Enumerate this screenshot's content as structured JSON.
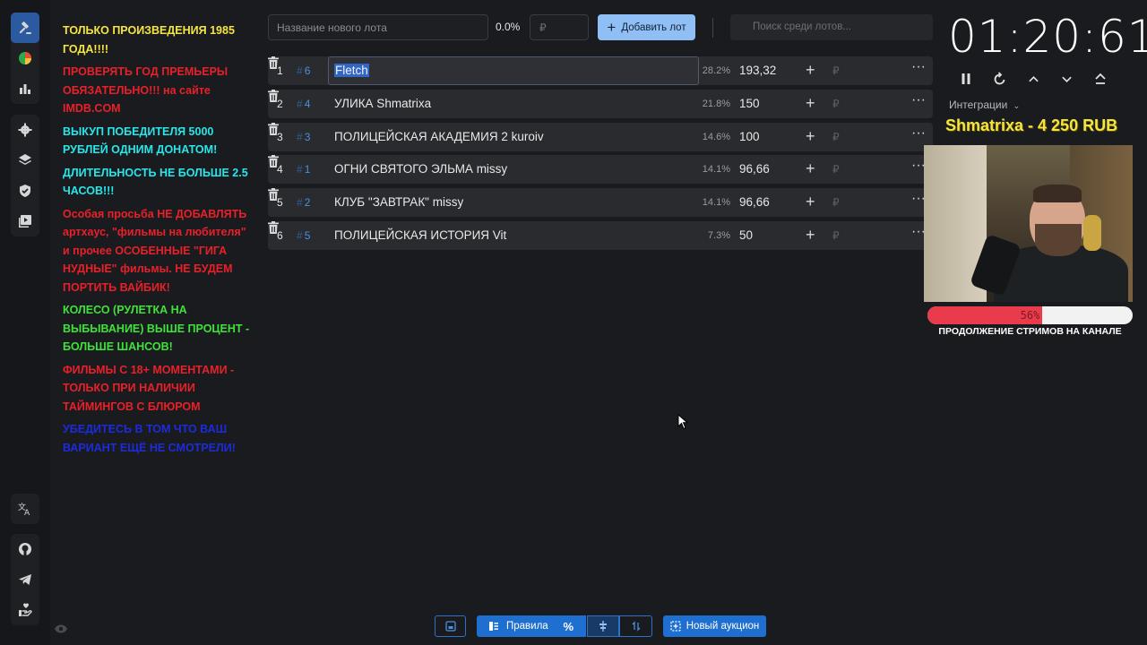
{
  "sidebar": {
    "top": [
      "gavel-icon",
      "pie-chart-icon",
      "bar-chart-icon"
    ],
    "middle": [
      "gear-icon",
      "layers-icon",
      "shield-check-icon",
      "video-library-icon"
    ],
    "bottom1": [
      "translate-icon"
    ],
    "bottom2": [
      "github-icon",
      "telegram-icon",
      "hand-heart-icon"
    ]
  },
  "rules": [
    {
      "text": "ТОЛЬКО ПРОИЗВЕДЕНИЯ 1985 ГОДА!!!!",
      "color": "yellow"
    },
    {
      "text": "ПРОВЕРЯТЬ ГОД ПРЕМЬЕРЫ ОБЯЗАТЕЛЬНО!!! на сайте IMDB.COM",
      "color": "red"
    },
    {
      "text": "ВЫКУП ПОБЕДИТЕЛЯ 5000 РУБЛЕЙ ОДНИМ ДОНАТОМ!",
      "color": "cyan"
    },
    {
      "text": "ДЛИТЕЛЬНОСТЬ НЕ БОЛЬШЕ 2.5 ЧАСОВ!!!",
      "color": "cyan"
    },
    {
      "text": "Особая просьба НЕ ДОБАВЛЯТЬ артхаус, \"фильмы на любителя\" и прочее ОСОБЕННЫЕ \"ГИГА НУДНЫЕ\" фильмы. НЕ БУДЕМ ПОРТИТЬ ВАЙБИК!",
      "color": "red"
    },
    {
      "text": "КОЛЕСО (РУЛЕТКА НА ВЫБЫВАНИЕ) ВЫШЕ ПРОЦЕНТ - БОЛЬШЕ ШАНСОВ!",
      "color": "green"
    },
    {
      "text": "ФИЛЬМЫ С 18+ МОМЕНТАМИ - ТОЛЬКО ПРИ НАЛИЧИИ ТАЙМИНГОВ С БЛЮРОМ",
      "color": "red"
    },
    {
      "text": "УБЕДИТЕСЬ В ТОМ ЧТО ВАШ ВАРИАНТ ЕЩЁ НЕ СМОТРЕЛИ!",
      "color": "blue"
    }
  ],
  "topbar": {
    "lot_name_placeholder": "Название нового лота",
    "percent": "0.0%",
    "currency_placeholder": "₽",
    "add_button": "Добавить лот",
    "search_placeholder": "Поиск среди лотов..."
  },
  "lots": [
    {
      "index": "1",
      "id": "6",
      "name": "Fletch",
      "share": "28.2%",
      "amount": "193,32",
      "editing": true
    },
    {
      "index": "2",
      "id": "4",
      "name": "УЛИКА Shmatrixa",
      "share": "21.8%",
      "amount": "150",
      "editing": false
    },
    {
      "index": "3",
      "id": "3",
      "name": "ПОЛИЦЕЙСКАЯ АКАДЕМИЯ 2 kuroiv",
      "share": "14.6%",
      "amount": "100",
      "editing": false
    },
    {
      "index": "4",
      "id": "1",
      "name": "ОГНИ СВЯТОГО ЭЛЬМА missy",
      "share": "14.1%",
      "amount": "96,66",
      "editing": false
    },
    {
      "index": "5",
      "id": "2",
      "name": "КЛУБ \"ЗАВТРАК\" missy",
      "share": "14.1%",
      "amount": "96,66",
      "editing": false
    },
    {
      "index": "6",
      "id": "5",
      "name": "ПОЛИЦЕЙСКАЯ ИСТОРИЯ Vit",
      "share": "7.3%",
      "amount": "50",
      "editing": false
    }
  ],
  "lot_row": {
    "hash": "#",
    "add": "+",
    "currency": "₽",
    "more": "···"
  },
  "bottom_toolbar": {
    "rules_label": "Правила",
    "percent_symbol": "%",
    "new_auction_label": "Новый аукцион"
  },
  "timer": {
    "value": "01:20:61",
    "controls": [
      "pause-icon",
      "restart-icon",
      "chevron-up-icon",
      "chevron-down-icon",
      "chevron-double-up-icon"
    ]
  },
  "integrations_label": "Интеграции",
  "donation": "Shmatrixa - 4 250 RUB",
  "stream_goal": {
    "percent": 56,
    "percent_text": "56%",
    "caption": "ПРОДОЛЖЕНИЕ СТРИМОВ НА КАНАЛЕ"
  },
  "colors": {
    "accent": "#1f6fd1",
    "add_button_bg": "#8fbff5",
    "progress_fill": "#ea3b4c",
    "donation_text": "#f4e542"
  }
}
